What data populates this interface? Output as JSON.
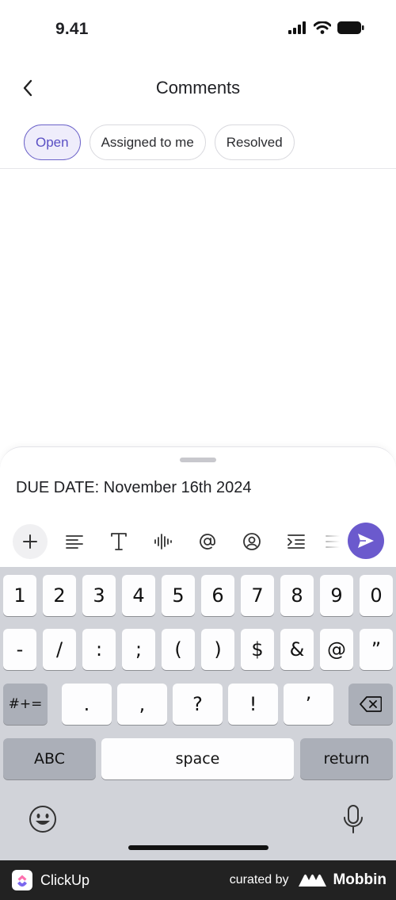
{
  "status_bar": {
    "time": "9.41",
    "icons": [
      "signal-icon",
      "wifi-icon",
      "battery-icon"
    ]
  },
  "header": {
    "title": "Comments",
    "back_icon": "chevron-left-icon"
  },
  "filters": [
    {
      "label": "Open",
      "active": true
    },
    {
      "label": "Assigned to me",
      "active": false
    },
    {
      "label": "Resolved",
      "active": false
    }
  ],
  "composer": {
    "text": "DUE DATE: November 16th 2024",
    "toolbar_icons": [
      "plus-icon",
      "align-icon",
      "text-format-icon",
      "voice-icon",
      "mention-icon",
      "assign-icon",
      "indent-icon",
      "list-icon"
    ],
    "send_icon": "send-icon"
  },
  "keyboard": {
    "row1": [
      "1",
      "2",
      "3",
      "4",
      "5",
      "6",
      "7",
      "8",
      "9",
      "0"
    ],
    "row2": [
      "-",
      "/",
      ":",
      ";",
      "(",
      ")",
      "$",
      "&",
      "@",
      "”"
    ],
    "row3_symbols": "#+=",
    "row3": [
      ".",
      ",",
      "?",
      "!",
      "’"
    ],
    "abc": "ABC",
    "space": "space",
    "return": "return"
  },
  "footer": {
    "app_name": "ClickUp",
    "curated_by": "curated by",
    "brand": "Mobbin"
  },
  "colors": {
    "accent": "#6b5acd",
    "chip_active_bg": "#efedfb",
    "keyboard_bg": "#d1d3d9",
    "footer_bg": "#222222"
  }
}
